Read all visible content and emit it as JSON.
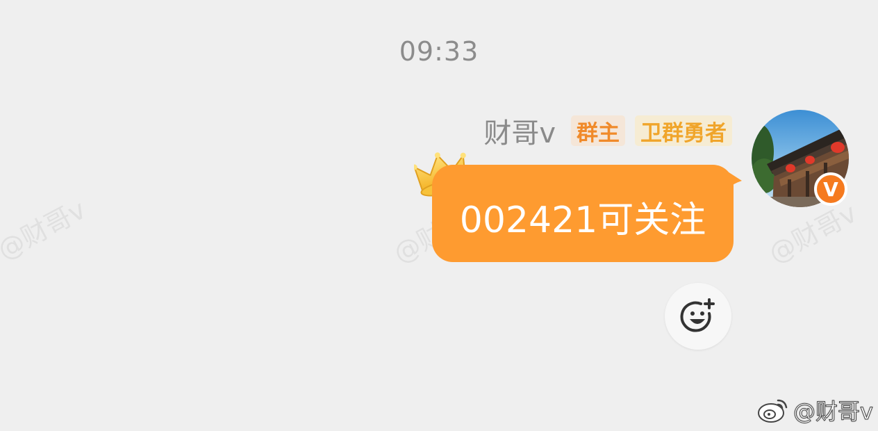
{
  "watermarks": [
    "@财哥v",
    "@财哥v",
    "@财哥v"
  ],
  "timestamp": "09:33",
  "message": {
    "sender": "财哥v",
    "badges": [
      "群主",
      "卫群勇者"
    ],
    "text": "002421可关注",
    "bubble_color": "#fe9b30"
  },
  "avatar": {
    "verified_badge": "V",
    "badge_color": "#f57a1f"
  },
  "reaction_button": {
    "icon": "add-emoji-icon"
  },
  "footer_watermark": {
    "icon": "weibo-logo-icon",
    "text": "@财哥v"
  }
}
